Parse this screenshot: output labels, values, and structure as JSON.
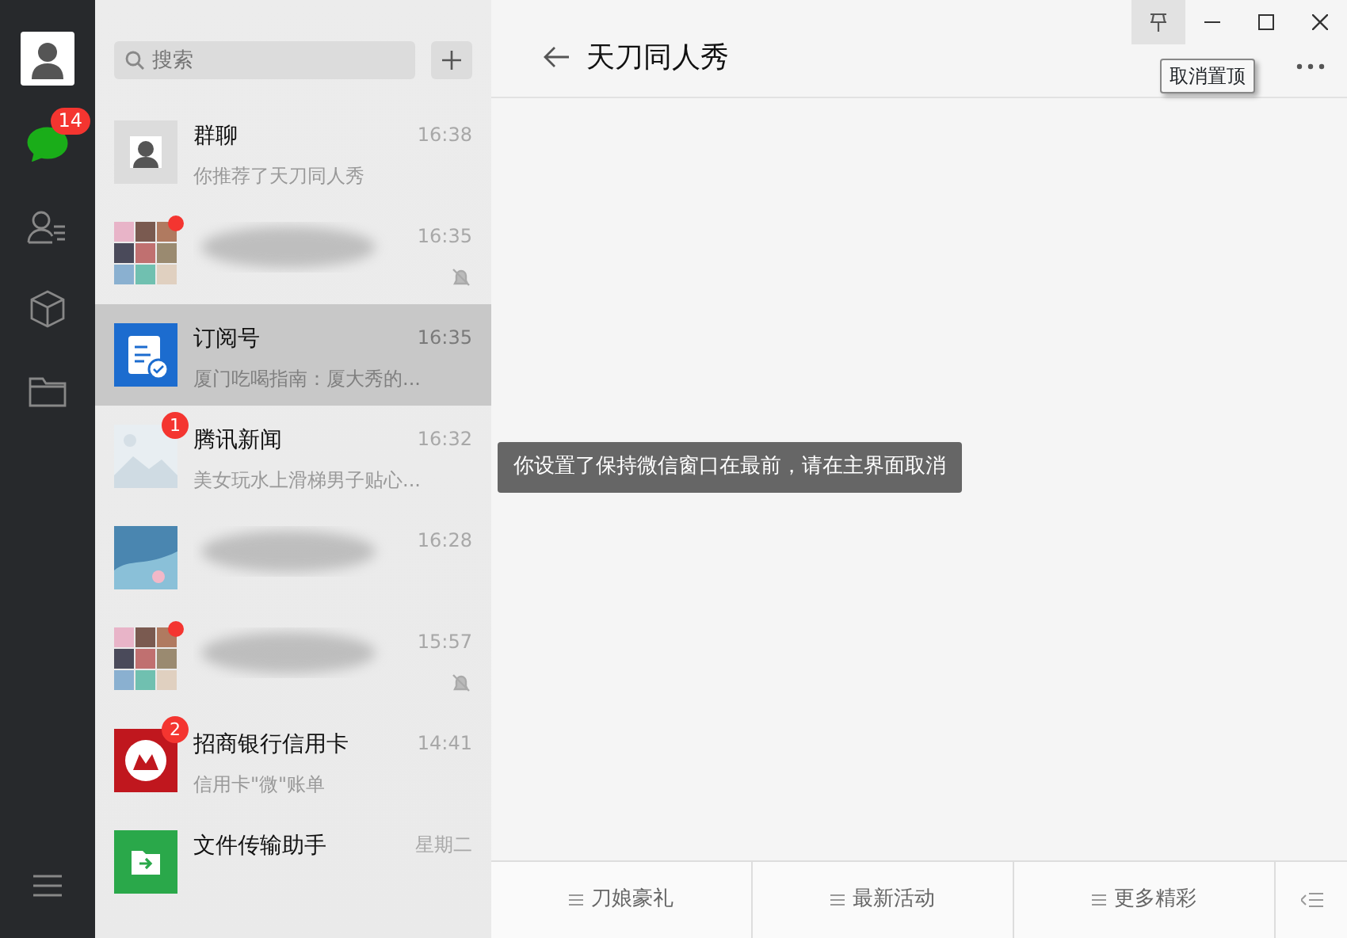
{
  "sidebar": {
    "unread_badge": "14",
    "items": [
      {
        "kind": "chats",
        "selected": true
      },
      {
        "kind": "contacts",
        "selected": false
      },
      {
        "kind": "favorites",
        "selected": false
      },
      {
        "kind": "files",
        "selected": false
      }
    ]
  },
  "search": {
    "placeholder": "搜索"
  },
  "chats": [
    {
      "kind": "chat",
      "avatar": {
        "kind": "profile"
      },
      "name": "群聊",
      "preview": "你推荐了天刀同人秀",
      "time": "16:38",
      "muted": false,
      "unread_dot": false,
      "selected": false
    },
    {
      "kind": "blurred",
      "avatar": {
        "kind": "grid"
      },
      "time": "16:35",
      "muted": true,
      "unread_dot": true,
      "selected": false
    },
    {
      "kind": "chat",
      "avatar": {
        "kind": "doc"
      },
      "name": "订阅号",
      "preview": "厦门吃喝指南：厦大秀的...",
      "time": "16:35",
      "muted": false,
      "unread_dot": false,
      "selected": true
    },
    {
      "kind": "chat",
      "avatar": {
        "kind": "news"
      },
      "name": "腾讯新闻",
      "preview": "美女玩水上滑梯男子贴心...",
      "time": "16:32",
      "badge": "1",
      "muted": false,
      "unread_dot": false,
      "selected": false
    },
    {
      "kind": "blurred",
      "avatar": {
        "kind": "photo"
      },
      "time": "16:28",
      "muted": false,
      "unread_dot": false,
      "selected": false
    },
    {
      "kind": "blurred",
      "avatar": {
        "kind": "grid"
      },
      "time": "15:57",
      "muted": true,
      "unread_dot": true,
      "selected": false
    },
    {
      "kind": "chat",
      "avatar": {
        "kind": "bank"
      },
      "name": "招商银行信用卡",
      "preview": "信用卡\"微\"账单",
      "time": "14:41",
      "badge": "2",
      "muted": false,
      "unread_dot": false,
      "selected": false
    },
    {
      "kind": "chat",
      "avatar": {
        "kind": "folder"
      },
      "name": "文件传输助手",
      "time": "星期二",
      "muted": false,
      "unread_dot": false,
      "selected": false
    }
  ],
  "conversation": {
    "title": "天刀同人秀",
    "pinned": true,
    "tooltip": "取消置顶",
    "notice": "你设置了保持微信窗口在最前，请在主界面取消",
    "menu": [
      {
        "label": "刀娘豪礼"
      },
      {
        "label": "最新活动"
      },
      {
        "label": "更多精彩"
      }
    ]
  }
}
